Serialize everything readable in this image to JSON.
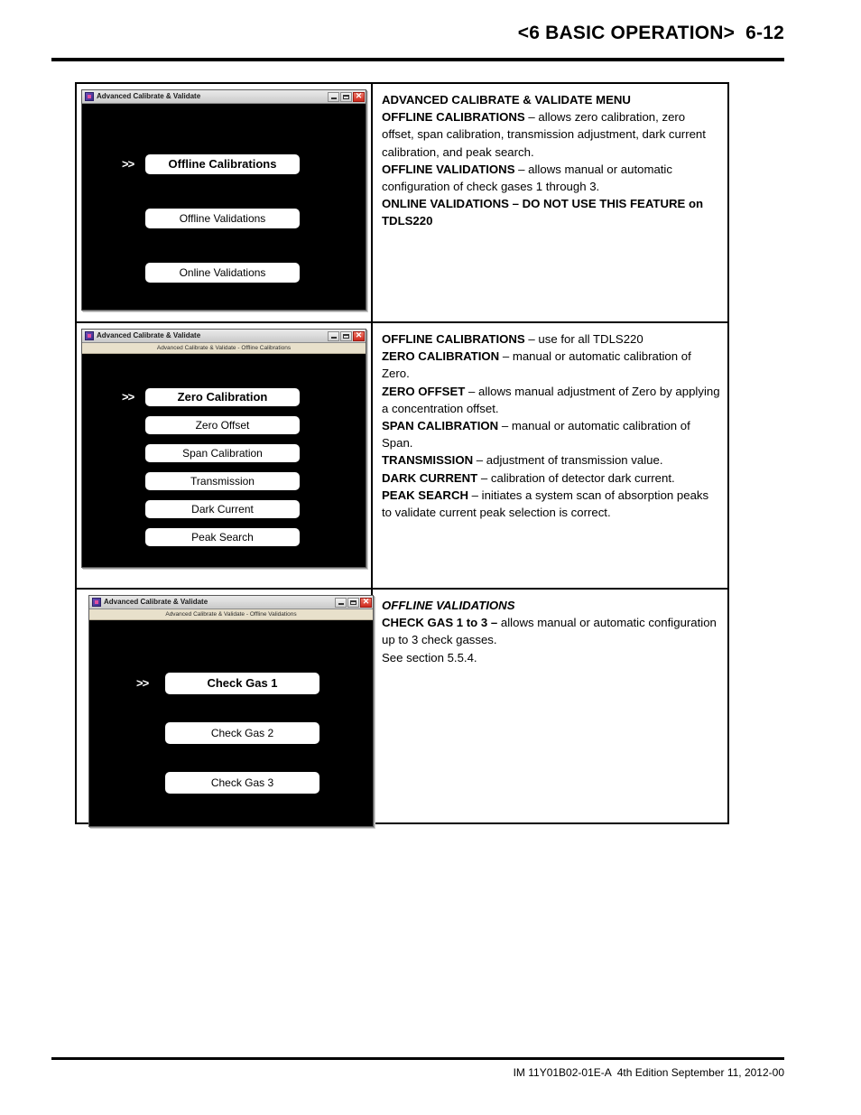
{
  "header": {
    "title": "<6 BASIC OPERATION>  6-12"
  },
  "footer": {
    "text": "IM 11Y01B02-01E-A  4th Edition September 11, 2012-00"
  },
  "window_chrome": {
    "title": "Advanced Calibrate & Validate",
    "minimize_label": "_",
    "maximize_label": "□",
    "close_label": "✕"
  },
  "rows": [
    {
      "screenshot": {
        "title": "Advanced Calibrate & Validate",
        "subtitle": "",
        "marker": ">>",
        "buttons": [
          {
            "label": "Offline Calibrations",
            "selected": true
          },
          {
            "label": "Offline Validations",
            "selected": false
          },
          {
            "label": "Online Validations",
            "selected": false
          }
        ]
      },
      "description": {
        "heading": "ADVANCED CALIBRATE & VALIDATE MENU",
        "entries": [
          {
            "term": "OFFLINE CALIBRATIONS",
            "dash": " – ",
            "body": "allows zero calibration, zero offset, span calibration, transmission adjustment, dark current calibration, and peak search."
          },
          {
            "term": "OFFLINE VALIDATIONS",
            "dash": " – ",
            "body": "allows manual or automatic configuration of check gases 1 through 3."
          },
          {
            "term": "ONLINE VALIDATIONS – DO NOT USE THIS FEATURE on TDLS220",
            "dash": "",
            "body": ""
          }
        ]
      }
    },
    {
      "screenshot": {
        "title": "Advanced Calibrate & Validate",
        "subtitle": "Advanced Calibrate & Validate - Offline Calibrations",
        "marker": ">>",
        "buttons": [
          {
            "label": "Zero Calibration",
            "selected": true
          },
          {
            "label": "Zero Offset",
            "selected": false
          },
          {
            "label": "Span Calibration",
            "selected": false
          },
          {
            "label": "Transmission",
            "selected": false
          },
          {
            "label": "Dark Current",
            "selected": false
          },
          {
            "label": "Peak Search",
            "selected": false
          }
        ]
      },
      "description": {
        "heading": "",
        "entries": [
          {
            "term": "OFFLINE CALIBRATIONS",
            "dash": " – ",
            "body": "use for all TDLS220"
          },
          {
            "term": "ZERO CALIBRATION",
            "dash": " – ",
            "body": "manual or automatic calibration of Zero."
          },
          {
            "term": "ZERO OFFSET",
            "dash": " – ",
            "body": "allows manual adjustment of Zero by applying a concentration offset."
          },
          {
            "term": "SPAN CALIBRATION",
            "dash": " – ",
            "body": "manual or automatic calibration of Span."
          },
          {
            "term": "TRANSMISSION",
            "dash": " – ",
            "body": "adjustment of transmission value."
          },
          {
            "term": "DARK CURRENT",
            "dash": " – ",
            "body": "calibration of detector dark current."
          },
          {
            "term": "PEAK SEARCH",
            "dash": " – ",
            "body": "initiates a system scan of absorption peaks to validate current peak selection is correct."
          }
        ]
      }
    },
    {
      "screenshot": {
        "title": "Advanced Calibrate & Validate",
        "subtitle": "Advanced Calibrate & Validate - Offline Validations",
        "marker": ">>",
        "buttons": [
          {
            "label": "Check Gas 1",
            "selected": true
          },
          {
            "label": "Check Gas 2",
            "selected": false
          },
          {
            "label": "Check Gas 3",
            "selected": false
          }
        ]
      },
      "description": {
        "heading_italic": "OFFLINE VALIDATIONS",
        "entries": [
          {
            "term": "CHECK GAS 1 to 3 –",
            "dash": " ",
            "body": "allows manual or automatic configuration up to 3 check gasses."
          },
          {
            "term": "",
            "dash": "",
            "body": "See section 5.5.4."
          }
        ]
      }
    }
  ]
}
